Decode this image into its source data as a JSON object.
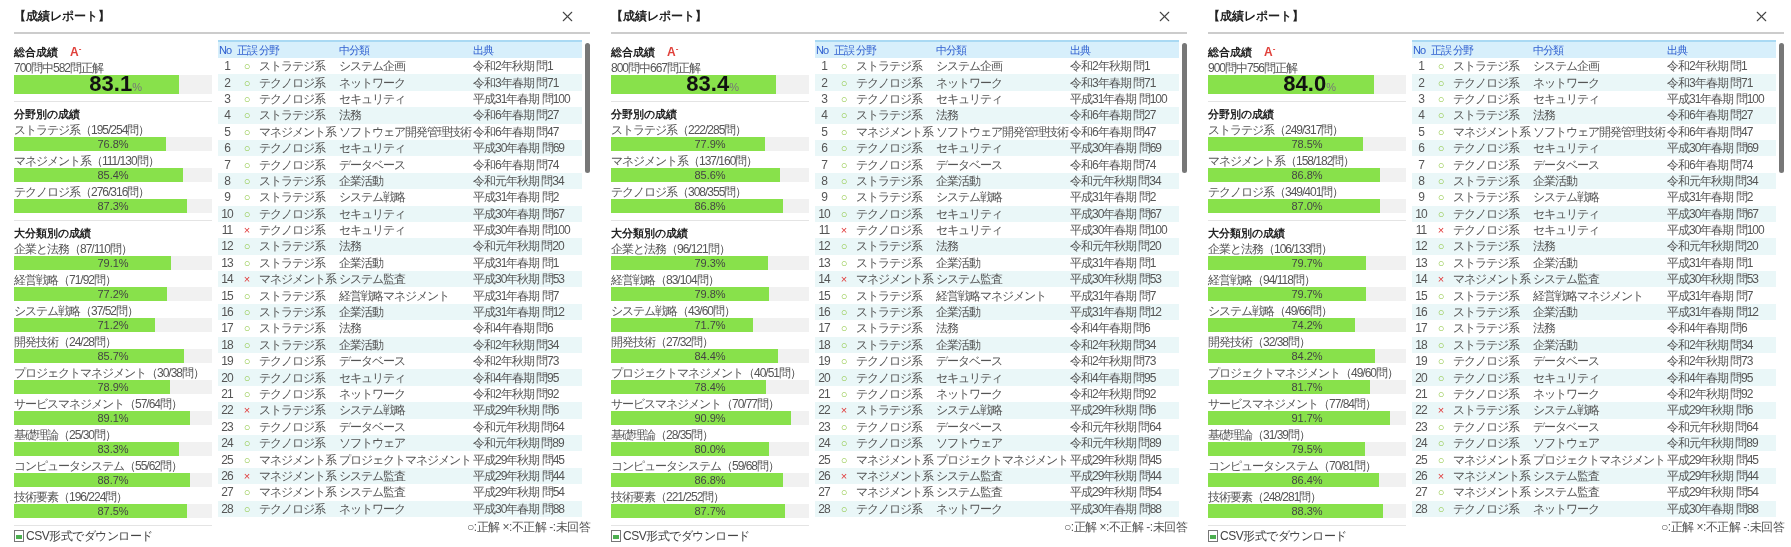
{
  "panels": [
    {
      "title": "【成績レポート】",
      "overall": {
        "heading": "総合成績",
        "grade": "A$^{-}$",
        "summary": "700問中582問正解",
        "score": "83.1",
        "unit": "%",
        "level": 0.831
      },
      "sections": [
        {
          "heading": "分野別の成績",
          "items": [
            {
              "label": "ストラテジ系（195/254問）",
              "value": "76.8%",
              "level": 0.768
            },
            {
              "label": "マネジメント系（111/130問）",
              "value": "85.4%",
              "level": 0.854
            },
            {
              "label": "テクノロジ系（276/316問）",
              "value": "87.3%",
              "level": 0.873
            }
          ]
        },
        {
          "heading": "大分類別の成績",
          "items": [
            {
              "label": "企業と法務（87/110問）",
              "value": "79.1%",
              "level": 0.791
            },
            {
              "label": "経営戦略（71/92問）",
              "value": "77.2%",
              "level": 0.772
            },
            {
              "label": "システム戦略（37/52問）",
              "value": "71.2%",
              "level": 0.712
            },
            {
              "label": "開発技術（24/28問）",
              "value": "85.7%",
              "level": 0.857
            },
            {
              "label": "プロジェクトマネジメント（30/38問）",
              "value": "78.9%",
              "level": 0.789
            },
            {
              "label": "サービスマネジメント（57/64問）",
              "value": "89.1%",
              "level": 0.891
            },
            {
              "label": "基礎理論（25/30問）",
              "value": "83.3%",
              "level": 0.833
            },
            {
              "label": "コンピュータシステム（55/62問）",
              "value": "88.7%",
              "level": 0.887
            },
            {
              "label": "技術要素（196/224問）",
              "value": "87.5%",
              "level": 0.875
            }
          ]
        }
      ],
      "table": {
        "columns": [
          "No",
          "正誤",
          "分野",
          "中分類",
          "出典"
        ],
        "rows": [
          {
            "no": "1",
            "correct": true,
            "mark": "○",
            "field": "ストラテジ系",
            "category": "システム企画",
            "source": "令和2年秋期 問1"
          },
          {
            "no": "2",
            "correct": true,
            "mark": "○",
            "field": "テクノロジ系",
            "category": "ネットワーク",
            "source": "令和3年春期 問71"
          },
          {
            "no": "3",
            "correct": true,
            "mark": "○",
            "field": "テクノロジ系",
            "category": "セキュリティ",
            "source": "平成31年春期 問100"
          },
          {
            "no": "4",
            "correct": true,
            "mark": "○",
            "field": "ストラテジ系",
            "category": "法務",
            "source": "令和6年春期 問27"
          },
          {
            "no": "5",
            "correct": true,
            "mark": "○",
            "field": "マネジメント系",
            "category": "ソフトウェア開発管理技術",
            "source": "令和6年春期 問47"
          },
          {
            "no": "6",
            "correct": true,
            "mark": "○",
            "field": "テクノロジ系",
            "category": "セキュリティ",
            "source": "平成30年春期 問69"
          },
          {
            "no": "7",
            "correct": true,
            "mark": "○",
            "field": "テクノロジ系",
            "category": "データベース",
            "source": "令和6年春期 問74"
          },
          {
            "no": "8",
            "correct": true,
            "mark": "○",
            "field": "ストラテジ系",
            "category": "企業活動",
            "source": "令和元年秋期 問34"
          },
          {
            "no": "9",
            "correct": true,
            "mark": "○",
            "field": "ストラテジ系",
            "category": "システム戦略",
            "source": "平成31年春期 問2"
          },
          {
            "no": "10",
            "correct": true,
            "mark": "○",
            "field": "テクノロジ系",
            "category": "セキュリティ",
            "source": "平成30年春期 問67"
          },
          {
            "no": "11",
            "correct": false,
            "mark": "×",
            "field": "テクノロジ系",
            "category": "セキュリティ",
            "source": "平成30年春期 問100"
          },
          {
            "no": "12",
            "correct": true,
            "mark": "○",
            "field": "ストラテジ系",
            "category": "法務",
            "source": "令和元年秋期 問20"
          },
          {
            "no": "13",
            "correct": true,
            "mark": "○",
            "field": "ストラテジ系",
            "category": "企業活動",
            "source": "平成31年春期 問1"
          },
          {
            "no": "14",
            "correct": false,
            "mark": "×",
            "field": "マネジメント系",
            "category": "システム監査",
            "source": "平成30年秋期 問53"
          },
          {
            "no": "15",
            "correct": true,
            "mark": "○",
            "field": "ストラテジ系",
            "category": "経営戦略マネジメント",
            "source": "平成31年春期 問7"
          },
          {
            "no": "16",
            "correct": true,
            "mark": "○",
            "field": "ストラテジ系",
            "category": "企業活動",
            "source": "平成31年春期 問12"
          },
          {
            "no": "17",
            "correct": true,
            "mark": "○",
            "field": "ストラテジ系",
            "category": "法務",
            "source": "令和4年春期 問6"
          },
          {
            "no": "18",
            "correct": true,
            "mark": "○",
            "field": "ストラテジ系",
            "category": "企業活動",
            "source": "令和2年秋期 問34"
          },
          {
            "no": "19",
            "correct": true,
            "mark": "○",
            "field": "テクノロジ系",
            "category": "データベース",
            "source": "令和2年秋期 問73"
          },
          {
            "no": "20",
            "correct": true,
            "mark": "○",
            "field": "テクノロジ系",
            "category": "セキュリティ",
            "source": "令和4年春期 問95"
          },
          {
            "no": "21",
            "correct": true,
            "mark": "○",
            "field": "テクノロジ系",
            "category": "ネットワーク",
            "source": "令和2年秋期 問92"
          },
          {
            "no": "22",
            "correct": false,
            "mark": "×",
            "field": "ストラテジ系",
            "category": "システム戦略",
            "source": "平成29年秋期 問6"
          },
          {
            "no": "23",
            "correct": true,
            "mark": "○",
            "field": "テクノロジ系",
            "category": "データベース",
            "source": "令和元年秋期 問64"
          },
          {
            "no": "24",
            "correct": true,
            "mark": "○",
            "field": "テクノロジ系",
            "category": "ソフトウェア",
            "source": "令和元年秋期 問89"
          },
          {
            "no": "25",
            "correct": true,
            "mark": "○",
            "field": "マネジメント系",
            "category": "プロジェクトマネジメント",
            "source": "平成29年秋期 問45"
          },
          {
            "no": "26",
            "correct": false,
            "mark": "×",
            "field": "マネジメント系",
            "category": "システム監査",
            "source": "平成29年秋期 問44"
          },
          {
            "no": "27",
            "correct": true,
            "mark": "○",
            "field": "マネジメント系",
            "category": "システム監査",
            "source": "平成29年秋期 問54"
          },
          {
            "no": "28",
            "correct": true,
            "mark": "○",
            "field": "テクノロジ系",
            "category": "ネットワーク",
            "source": "平成30年春期 問88"
          }
        ]
      },
      "download_link": "CSV形式でダウンロード",
      "legend": "○:正解 ×:不正解 -:未回答"
    },
    {
      "title": "【成績レポート】",
      "overall": {
        "heading": "総合成績",
        "grade": "A$^{-}$",
        "summary": "800問中667問正解",
        "score": "83.4",
        "unit": "%",
        "level": 0.834
      },
      "sections": [
        {
          "heading": "分野別の成績",
          "items": [
            {
              "label": "ストラテジ系（222/285問）",
              "value": "77.9%",
              "level": 0.779
            },
            {
              "label": "マネジメント系（137/160問）",
              "value": "85.6%",
              "level": 0.856
            },
            {
              "label": "テクノロジ系（308/355問）",
              "value": "86.8%",
              "level": 0.868
            }
          ]
        },
        {
          "heading": "大分類別の成績",
          "items": [
            {
              "label": "企業と法務（96/121問）",
              "value": "79.3%",
              "level": 0.793
            },
            {
              "label": "経営戦略（83/104問）",
              "value": "79.8%",
              "level": 0.798
            },
            {
              "label": "システム戦略（43/60問）",
              "value": "71.7%",
              "level": 0.717
            },
            {
              "label": "開発技術（27/32問）",
              "value": "84.4%",
              "level": 0.844
            },
            {
              "label": "プロジェクトマネジメント（40/51問）",
              "value": "78.4%",
              "level": 0.784
            },
            {
              "label": "サービスマネジメント（70/77問）",
              "value": "90.9%",
              "level": 0.909
            },
            {
              "label": "基礎理論（28/35問）",
              "value": "80.0%",
              "level": 0.8
            },
            {
              "label": "コンピュータシステム（59/68問）",
              "value": "86.8%",
              "level": 0.868
            },
            {
              "label": "技術要素（221/252問）",
              "value": "87.7%",
              "level": 0.877
            }
          ]
        }
      ],
      "table": {
        "columns": [
          "No",
          "正誤",
          "分野",
          "中分類",
          "出典"
        ],
        "rows": [
          {
            "no": "1",
            "correct": true,
            "mark": "○",
            "field": "ストラテジ系",
            "category": "システム企画",
            "source": "令和2年秋期 問1"
          },
          {
            "no": "2",
            "correct": true,
            "mark": "○",
            "field": "テクノロジ系",
            "category": "ネットワーク",
            "source": "令和3年春期 問71"
          },
          {
            "no": "3",
            "correct": true,
            "mark": "○",
            "field": "テクノロジ系",
            "category": "セキュリティ",
            "source": "平成31年春期 問100"
          },
          {
            "no": "4",
            "correct": true,
            "mark": "○",
            "field": "ストラテジ系",
            "category": "法務",
            "source": "令和6年春期 問27"
          },
          {
            "no": "5",
            "correct": true,
            "mark": "○",
            "field": "マネジメント系",
            "category": "ソフトウェア開発管理技術",
            "source": "令和6年春期 問47"
          },
          {
            "no": "6",
            "correct": true,
            "mark": "○",
            "field": "テクノロジ系",
            "category": "セキュリティ",
            "source": "平成30年春期 問69"
          },
          {
            "no": "7",
            "correct": true,
            "mark": "○",
            "field": "テクノロジ系",
            "category": "データベース",
            "source": "令和6年春期 問74"
          },
          {
            "no": "8",
            "correct": true,
            "mark": "○",
            "field": "ストラテジ系",
            "category": "企業活動",
            "source": "令和元年秋期 問34"
          },
          {
            "no": "9",
            "correct": true,
            "mark": "○",
            "field": "ストラテジ系",
            "category": "システム戦略",
            "source": "平成31年春期 問2"
          },
          {
            "no": "10",
            "correct": true,
            "mark": "○",
            "field": "テクノロジ系",
            "category": "セキュリティ",
            "source": "平成30年春期 問67"
          },
          {
            "no": "11",
            "correct": false,
            "mark": "×",
            "field": "テクノロジ系",
            "category": "セキュリティ",
            "source": "平成30年春期 問100"
          },
          {
            "no": "12",
            "correct": true,
            "mark": "○",
            "field": "ストラテジ系",
            "category": "法務",
            "source": "令和元年秋期 問20"
          },
          {
            "no": "13",
            "correct": true,
            "mark": "○",
            "field": "ストラテジ系",
            "category": "企業活動",
            "source": "平成31年春期 問1"
          },
          {
            "no": "14",
            "correct": false,
            "mark": "×",
            "field": "マネジメント系",
            "category": "システム監査",
            "source": "平成30年秋期 問53"
          },
          {
            "no": "15",
            "correct": true,
            "mark": "○",
            "field": "ストラテジ系",
            "category": "経営戦略マネジメント",
            "source": "平成31年春期 問7"
          },
          {
            "no": "16",
            "correct": true,
            "mark": "○",
            "field": "ストラテジ系",
            "category": "企業活動",
            "source": "平成31年春期 問12"
          },
          {
            "no": "17",
            "correct": true,
            "mark": "○",
            "field": "ストラテジ系",
            "category": "法務",
            "source": "令和4年春期 問6"
          },
          {
            "no": "18",
            "correct": true,
            "mark": "○",
            "field": "ストラテジ系",
            "category": "企業活動",
            "source": "令和2年秋期 問34"
          },
          {
            "no": "19",
            "correct": true,
            "mark": "○",
            "field": "テクノロジ系",
            "category": "データベース",
            "source": "令和2年秋期 問73"
          },
          {
            "no": "20",
            "correct": true,
            "mark": "○",
            "field": "テクノロジ系",
            "category": "セキュリティ",
            "source": "令和4年春期 問95"
          },
          {
            "no": "21",
            "correct": true,
            "mark": "○",
            "field": "テクノロジ系",
            "category": "ネットワーク",
            "source": "令和2年秋期 問92"
          },
          {
            "no": "22",
            "correct": false,
            "mark": "×",
            "field": "ストラテジ系",
            "category": "システム戦略",
            "source": "平成29年秋期 問6"
          },
          {
            "no": "23",
            "correct": true,
            "mark": "○",
            "field": "テクノロジ系",
            "category": "データベース",
            "source": "令和元年秋期 問64"
          },
          {
            "no": "24",
            "correct": true,
            "mark": "○",
            "field": "テクノロジ系",
            "category": "ソフトウェア",
            "source": "令和元年秋期 問89"
          },
          {
            "no": "25",
            "correct": true,
            "mark": "○",
            "field": "マネジメント系",
            "category": "プロジェクトマネジメント",
            "source": "平成29年秋期 問45"
          },
          {
            "no": "26",
            "correct": false,
            "mark": "×",
            "field": "マネジメント系",
            "category": "システム監査",
            "source": "平成29年秋期 問44"
          },
          {
            "no": "27",
            "correct": true,
            "mark": "○",
            "field": "マネジメント系",
            "category": "システム監査",
            "source": "平成29年秋期 問54"
          },
          {
            "no": "28",
            "correct": true,
            "mark": "○",
            "field": "テクノロジ系",
            "category": "ネットワーク",
            "source": "平成30年春期 問88"
          }
        ]
      },
      "download_link": "CSV形式でダウンロード",
      "legend": "○:正解 ×:不正解 -:未回答"
    },
    {
      "title": "【成績レポート】",
      "overall": {
        "heading": "総合成績",
        "grade": "A$^{-}$",
        "summary": "900問中756問正解",
        "score": "84.0",
        "unit": "%",
        "level": 0.84
      },
      "sections": [
        {
          "heading": "分野別の成績",
          "items": [
            {
              "label": "ストラテジ系（249/317問）",
              "value": "78.5%",
              "level": 0.785
            },
            {
              "label": "マネジメント系（158/182問）",
              "value": "86.8%",
              "level": 0.868
            },
            {
              "label": "テクノロジ系（349/401問）",
              "value": "87.0%",
              "level": 0.87
            }
          ]
        },
        {
          "heading": "大分類別の成績",
          "items": [
            {
              "label": "企業と法務（106/133問）",
              "value": "79.7%",
              "level": 0.797
            },
            {
              "label": "経営戦略（94/118問）",
              "value": "79.7%",
              "level": 0.797
            },
            {
              "label": "システム戦略（49/66問）",
              "value": "74.2%",
              "level": 0.742
            },
            {
              "label": "開発技術（32/38問）",
              "value": "84.2%",
              "level": 0.842
            },
            {
              "label": "プロジェクトマネジメント（49/60問）",
              "value": "81.7%",
              "level": 0.817
            },
            {
              "label": "サービスマネジメント（77/84問）",
              "value": "91.7%",
              "level": 0.917
            },
            {
              "label": "基礎理論（31/39問）",
              "value": "79.5%",
              "level": 0.795
            },
            {
              "label": "コンピュータシステム（70/81問）",
              "value": "86.4%",
              "level": 0.864
            },
            {
              "label": "技術要素（248/281問）",
              "value": "88.3%",
              "level": 0.883
            }
          ]
        }
      ],
      "table": {
        "columns": [
          "No",
          "正誤",
          "分野",
          "中分類",
          "出典"
        ],
        "rows": [
          {
            "no": "1",
            "correct": true,
            "mark": "○",
            "field": "ストラテジ系",
            "category": "システム企画",
            "source": "令和2年秋期 問1"
          },
          {
            "no": "2",
            "correct": true,
            "mark": "○",
            "field": "テクノロジ系",
            "category": "ネットワーク",
            "source": "令和3年春期 問71"
          },
          {
            "no": "3",
            "correct": true,
            "mark": "○",
            "field": "テクノロジ系",
            "category": "セキュリティ",
            "source": "平成31年春期 問100"
          },
          {
            "no": "4",
            "correct": true,
            "mark": "○",
            "field": "ストラテジ系",
            "category": "法務",
            "source": "令和6年春期 問27"
          },
          {
            "no": "5",
            "correct": true,
            "mark": "○",
            "field": "マネジメント系",
            "category": "ソフトウェア開発管理技術",
            "source": "令和6年春期 問47"
          },
          {
            "no": "6",
            "correct": true,
            "mark": "○",
            "field": "テクノロジ系",
            "category": "セキュリティ",
            "source": "平成30年春期 問69"
          },
          {
            "no": "7",
            "correct": true,
            "mark": "○",
            "field": "テクノロジ系",
            "category": "データベース",
            "source": "令和6年春期 問74"
          },
          {
            "no": "8",
            "correct": true,
            "mark": "○",
            "field": "ストラテジ系",
            "category": "企業活動",
            "source": "令和元年秋期 問34"
          },
          {
            "no": "9",
            "correct": true,
            "mark": "○",
            "field": "ストラテジ系",
            "category": "システム戦略",
            "source": "平成31年春期 問2"
          },
          {
            "no": "10",
            "correct": true,
            "mark": "○",
            "field": "テクノロジ系",
            "category": "セキュリティ",
            "source": "平成30年春期 問67"
          },
          {
            "no": "11",
            "correct": false,
            "mark": "×",
            "field": "テクノロジ系",
            "category": "セキュリティ",
            "source": "平成30年春期 問100"
          },
          {
            "no": "12",
            "correct": true,
            "mark": "○",
            "field": "ストラテジ系",
            "category": "法務",
            "source": "令和元年秋期 問20"
          },
          {
            "no": "13",
            "correct": true,
            "mark": "○",
            "field": "ストラテジ系",
            "category": "企業活動",
            "source": "平成31年春期 問1"
          },
          {
            "no": "14",
            "correct": false,
            "mark": "×",
            "field": "マネジメント系",
            "category": "システム監査",
            "source": "平成30年秋期 問53"
          },
          {
            "no": "15",
            "correct": true,
            "mark": "○",
            "field": "ストラテジ系",
            "category": "経営戦略マネジメント",
            "source": "平成31年春期 問7"
          },
          {
            "no": "16",
            "correct": true,
            "mark": "○",
            "field": "ストラテジ系",
            "category": "企業活動",
            "source": "平成31年春期 問12"
          },
          {
            "no": "17",
            "correct": true,
            "mark": "○",
            "field": "ストラテジ系",
            "category": "法務",
            "source": "令和4年春期 問6"
          },
          {
            "no": "18",
            "correct": true,
            "mark": "○",
            "field": "ストラテジ系",
            "category": "企業活動",
            "source": "令和2年秋期 問34"
          },
          {
            "no": "19",
            "correct": true,
            "mark": "○",
            "field": "テクノロジ系",
            "category": "データベース",
            "source": "令和2年秋期 問73"
          },
          {
            "no": "20",
            "correct": true,
            "mark": "○",
            "field": "テクノロジ系",
            "category": "セキュリティ",
            "source": "令和4年春期 問95"
          },
          {
            "no": "21",
            "correct": true,
            "mark": "○",
            "field": "テクノロジ系",
            "category": "ネットワーク",
            "source": "令和2年秋期 問92"
          },
          {
            "no": "22",
            "correct": false,
            "mark": "×",
            "field": "ストラテジ系",
            "category": "システム戦略",
            "source": "平成29年秋期 問6"
          },
          {
            "no": "23",
            "correct": true,
            "mark": "○",
            "field": "テクノロジ系",
            "category": "データベース",
            "source": "令和元年秋期 問64"
          },
          {
            "no": "24",
            "correct": true,
            "mark": "○",
            "field": "テクノロジ系",
            "category": "ソフトウェア",
            "source": "令和元年秋期 問89"
          },
          {
            "no": "25",
            "correct": true,
            "mark": "○",
            "field": "マネジメント系",
            "category": "プロジェクトマネジメント",
            "source": "平成29年秋期 問45"
          },
          {
            "no": "26",
            "correct": false,
            "mark": "×",
            "field": "マネジメント系",
            "category": "システム監査",
            "source": "平成29年秋期 問44"
          },
          {
            "no": "27",
            "correct": true,
            "mark": "○",
            "field": "マネジメント系",
            "category": "システム監査",
            "source": "平成29年秋期 問54"
          },
          {
            "no": "28",
            "correct": true,
            "mark": "○",
            "field": "テクノロジ系",
            "category": "ネットワーク",
            "source": "平成30年春期 問88"
          }
        ]
      },
      "download_link": "CSV形式でダウンロード",
      "legend": "○:正解 ×:不正解 -:未回答"
    }
  ]
}
